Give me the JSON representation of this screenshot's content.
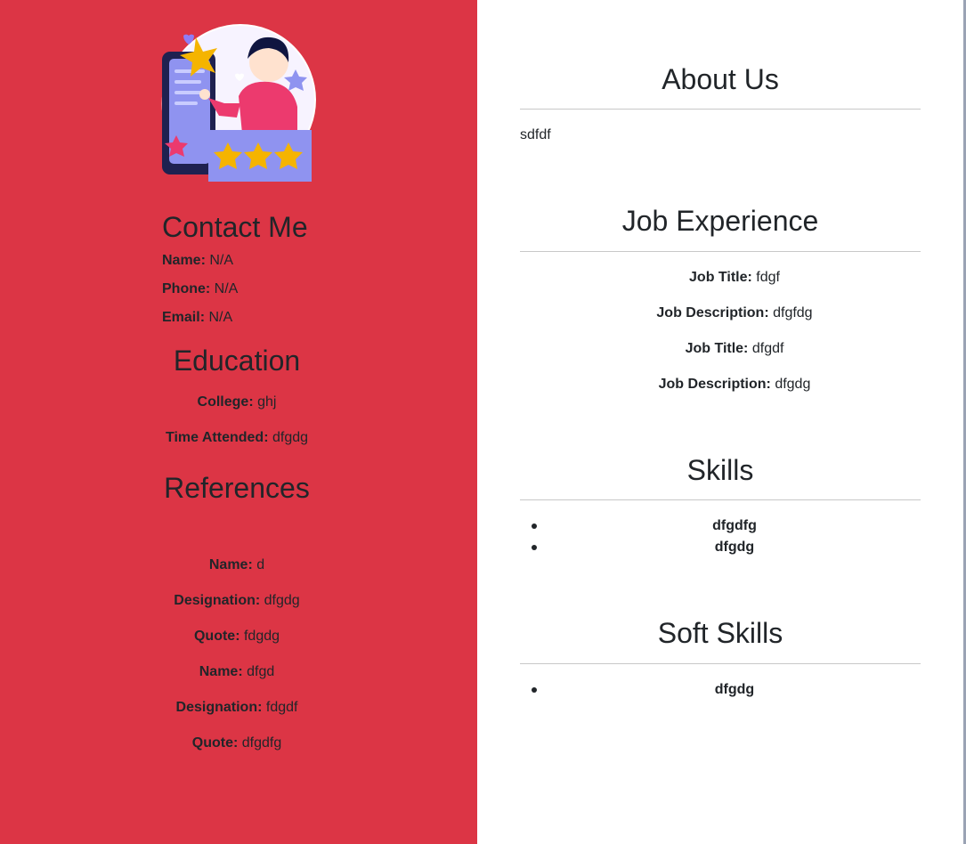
{
  "contact": {
    "heading": "Contact Me",
    "name_label": "Name:",
    "name_value": "N/A",
    "phone_label": "Phone:",
    "phone_value": "N/A",
    "email_label": "Email:",
    "email_value": "N/A"
  },
  "education": {
    "heading": "Education",
    "college_label": "College:",
    "college_value": "ghj",
    "time_label": "Time Attended:",
    "time_value": "dfgdg"
  },
  "references": {
    "heading": "References",
    "items": [
      {
        "name_label": "Name:",
        "name": "d",
        "designation_label": "Designation:",
        "designation": "dfgdg",
        "quote_label": "Quote:",
        "quote": "fdgdg"
      },
      {
        "name_label": "Name:",
        "name": "dfgd",
        "designation_label": "Designation:",
        "designation": "fdgdf",
        "quote_label": "Quote:",
        "quote": "dfgdfg"
      }
    ]
  },
  "about": {
    "heading": "About Us",
    "text": "sdfdf"
  },
  "job_experience": {
    "heading": "Job Experience",
    "items": [
      {
        "title_label": "Job Title:",
        "title": "fdgf",
        "desc_label": "Job Description:",
        "desc": "dfgfdg"
      },
      {
        "title_label": "Job Title:",
        "title": "dfgdf",
        "desc_label": "Job Description:",
        "desc": "dfgdg"
      }
    ]
  },
  "skills": {
    "heading": "Skills",
    "items": [
      "dfgdfg",
      "dfgdg"
    ]
  },
  "soft_skills": {
    "heading": "Soft Skills",
    "items": [
      "dfgdg"
    ]
  },
  "colors": {
    "sidebar": "#dc3545",
    "text": "#212529",
    "divider": "#c8c8c8"
  },
  "icons": {
    "illustration": "phone-rating-illustration-icon"
  }
}
